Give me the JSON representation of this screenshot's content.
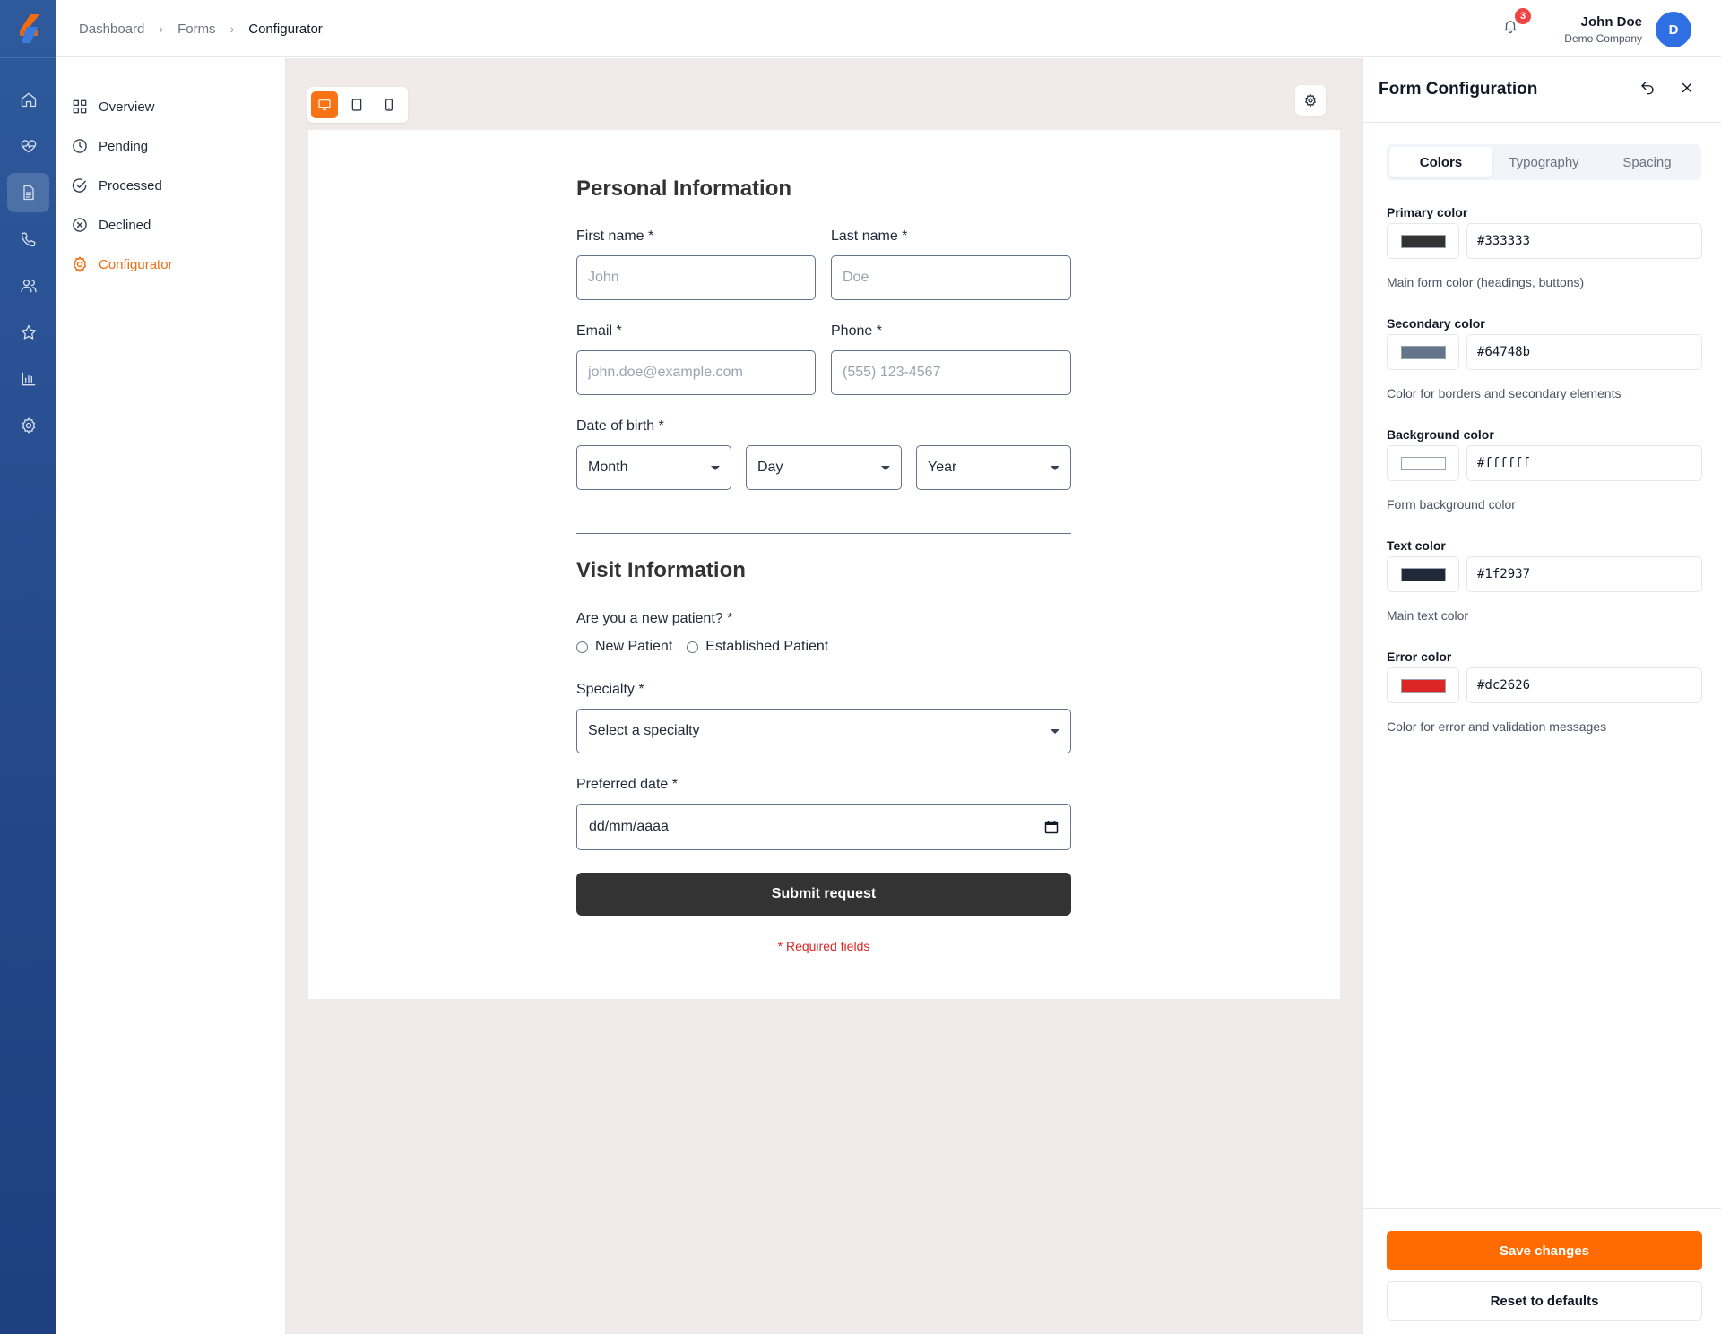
{
  "breadcrumb": [
    "Dashboard",
    "Forms",
    "Configurator"
  ],
  "notifications": {
    "count": "3"
  },
  "user": {
    "name": "John Doe",
    "company": "Demo Company",
    "initial": "D"
  },
  "rail": {
    "icons": [
      "home-icon",
      "heart-pulse-icon",
      "document-icon",
      "phone-icon",
      "users-icon",
      "star-icon",
      "bar-chart-icon",
      "gear-icon"
    ],
    "active": "document-icon"
  },
  "subnav": {
    "items": [
      {
        "label": "Overview",
        "icon": "grid-icon"
      },
      {
        "label": "Pending",
        "icon": "clock-icon"
      },
      {
        "label": "Processed",
        "icon": "check-circle-icon"
      },
      {
        "label": "Declined",
        "icon": "x-circle-icon"
      },
      {
        "label": "Configurator",
        "icon": "gear-icon"
      }
    ],
    "active": "Configurator"
  },
  "preview": {
    "device_modes": [
      "desktop",
      "tablet",
      "mobile"
    ],
    "active_mode": "desktop"
  },
  "form": {
    "personal_heading": "Personal Information",
    "first_name_label": "First name *",
    "first_name_placeholder": "John",
    "last_name_label": "Last name *",
    "last_name_placeholder": "Doe",
    "email_label": "Email *",
    "email_placeholder": "john.doe@example.com",
    "phone_label": "Phone *",
    "phone_placeholder": "(555) 123-4567",
    "dob_label": "Date of birth *",
    "dob_month": "Month",
    "dob_day": "Day",
    "dob_year": "Year",
    "visit_heading": "Visit Information",
    "new_patient_label": "Are you a new patient? *",
    "new_patient_option": "New Patient",
    "established_option": "Established Patient",
    "specialty_label": "Specialty *",
    "specialty_value": "Select a specialty",
    "preferred_date_label": "Preferred date *",
    "preferred_date_value": "dd/mm/aaaa",
    "submit_label": "Submit request",
    "required_note": "* Required fields"
  },
  "panel": {
    "title": "Form Configuration",
    "tabs": [
      "Colors",
      "Typography",
      "Spacing"
    ],
    "active_tab": "Colors",
    "colors": [
      {
        "label": "Primary color",
        "value": "#333333",
        "help": "Main form color (headings, buttons)"
      },
      {
        "label": "Secondary color",
        "value": "#64748b",
        "help": "Color for borders and secondary elements"
      },
      {
        "label": "Background color",
        "value": "#ffffff",
        "help": "Form background color"
      },
      {
        "label": "Text color",
        "value": "#1f2937",
        "help": "Main text color"
      },
      {
        "label": "Error color",
        "value": "#dc2626",
        "help": "Color for error and validation messages"
      }
    ],
    "save_label": "Save changes",
    "reset_label": "Reset to defaults"
  },
  "accent": "#ff6b00",
  "rail_color": "#24488a"
}
